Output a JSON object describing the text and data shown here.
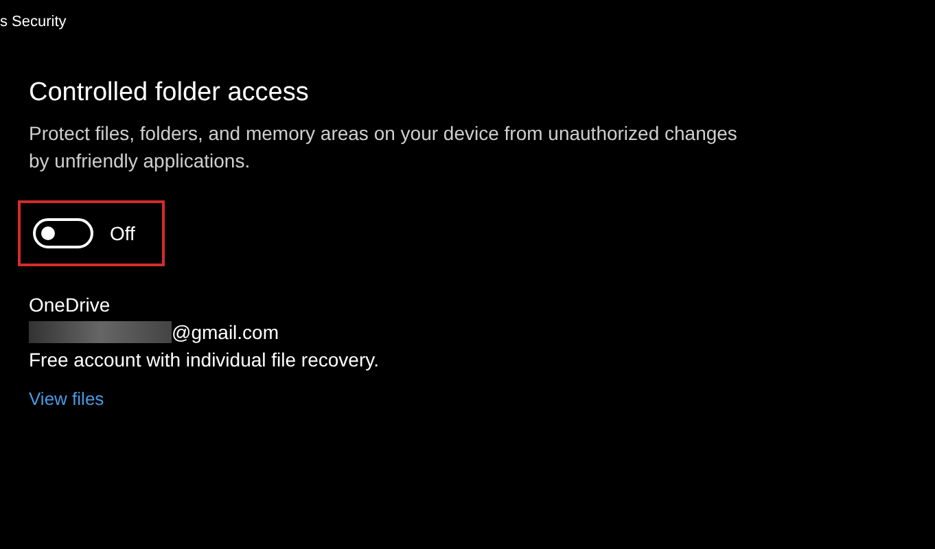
{
  "window": {
    "title": "s Security"
  },
  "section": {
    "heading": "Controlled folder access",
    "description": "Protect files, folders, and memory areas on your device from unauthorized changes by unfriendly applications."
  },
  "toggle": {
    "on": false,
    "label": "Off",
    "highlighted": true
  },
  "onedrive": {
    "title": "OneDrive",
    "email": "@gmail.com",
    "note": "Free account with individual file recovery.",
    "link": "View files"
  }
}
